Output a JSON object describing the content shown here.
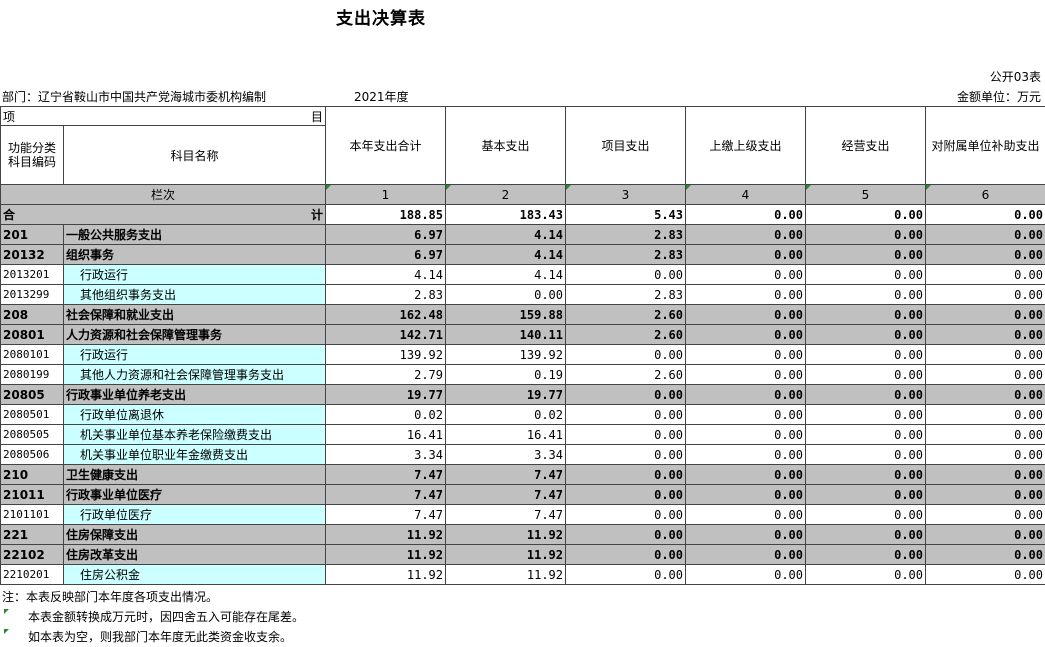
{
  "title": "支出决算表",
  "form_no": "公开03表",
  "department": "部门：辽宁省鞍山市中国共产党海城市委机构编制",
  "year": "2021年度",
  "unit": "金额单位：万元",
  "header": {
    "item_left": "项",
    "item_right": "目",
    "code_label": "功能分类科目编码",
    "name_label": "科目名称",
    "columns": [
      "本年支出合计",
      "基本支出",
      "项目支出",
      "上缴上级支出",
      "经营支出",
      "对附属单位补助支出"
    ],
    "lanci": "栏次",
    "col_numbers": [
      "1",
      "2",
      "3",
      "4",
      "5",
      "6"
    ]
  },
  "total": {
    "left": "合",
    "right": "计",
    "values": [
      "188.85",
      "183.43",
      "5.43",
      "0.00",
      "0.00",
      "0.00"
    ]
  },
  "rows": [
    {
      "level": 1,
      "code": "201",
      "name": "一般公共服务支出",
      "values": [
        "6.97",
        "4.14",
        "2.83",
        "0.00",
        "0.00",
        "0.00"
      ]
    },
    {
      "level": 2,
      "code": "20132",
      "name": "组织事务",
      "values": [
        "6.97",
        "4.14",
        "2.83",
        "0.00",
        "0.00",
        "0.00"
      ]
    },
    {
      "level": 3,
      "code": "2013201",
      "name": "行政运行",
      "values": [
        "4.14",
        "4.14",
        "0.00",
        "0.00",
        "0.00",
        "0.00"
      ]
    },
    {
      "level": 3,
      "code": "2013299",
      "name": "其他组织事务支出",
      "values": [
        "2.83",
        "0.00",
        "2.83",
        "0.00",
        "0.00",
        "0.00"
      ]
    },
    {
      "level": 1,
      "code": "208",
      "name": "社会保障和就业支出",
      "values": [
        "162.48",
        "159.88",
        "2.60",
        "0.00",
        "0.00",
        "0.00"
      ]
    },
    {
      "level": 2,
      "code": "20801",
      "name": "人力资源和社会保障管理事务",
      "values": [
        "142.71",
        "140.11",
        "2.60",
        "0.00",
        "0.00",
        "0.00"
      ]
    },
    {
      "level": 3,
      "code": "2080101",
      "name": "行政运行",
      "values": [
        "139.92",
        "139.92",
        "0.00",
        "0.00",
        "0.00",
        "0.00"
      ]
    },
    {
      "level": 3,
      "code": "2080199",
      "name": "其他人力资源和社会保障管理事务支出",
      "values": [
        "2.79",
        "0.19",
        "2.60",
        "0.00",
        "0.00",
        "0.00"
      ]
    },
    {
      "level": 2,
      "code": "20805",
      "name": "行政事业单位养老支出",
      "values": [
        "19.77",
        "19.77",
        "0.00",
        "0.00",
        "0.00",
        "0.00"
      ]
    },
    {
      "level": 3,
      "code": "2080501",
      "name": "行政单位离退休",
      "values": [
        "0.02",
        "0.02",
        "0.00",
        "0.00",
        "0.00",
        "0.00"
      ]
    },
    {
      "level": 3,
      "code": "2080505",
      "name": "机关事业单位基本养老保险缴费支出",
      "values": [
        "16.41",
        "16.41",
        "0.00",
        "0.00",
        "0.00",
        "0.00"
      ]
    },
    {
      "level": 3,
      "code": "2080506",
      "name": "机关事业单位职业年金缴费支出",
      "values": [
        "3.34",
        "3.34",
        "0.00",
        "0.00",
        "0.00",
        "0.00"
      ]
    },
    {
      "level": 1,
      "code": "210",
      "name": "卫生健康支出",
      "values": [
        "7.47",
        "7.47",
        "0.00",
        "0.00",
        "0.00",
        "0.00"
      ]
    },
    {
      "level": 2,
      "code": "21011",
      "name": "行政事业单位医疗",
      "values": [
        "7.47",
        "7.47",
        "0.00",
        "0.00",
        "0.00",
        "0.00"
      ]
    },
    {
      "level": 3,
      "code": "2101101",
      "name": "行政单位医疗",
      "values": [
        "7.47",
        "7.47",
        "0.00",
        "0.00",
        "0.00",
        "0.00"
      ]
    },
    {
      "level": 1,
      "code": "221",
      "name": "住房保障支出",
      "values": [
        "11.92",
        "11.92",
        "0.00",
        "0.00",
        "0.00",
        "0.00"
      ]
    },
    {
      "level": 2,
      "code": "22102",
      "name": "住房改革支出",
      "values": [
        "11.92",
        "11.92",
        "0.00",
        "0.00",
        "0.00",
        "0.00"
      ]
    },
    {
      "level": 3,
      "code": "2210201",
      "name": "住房公积金",
      "values": [
        "11.92",
        "11.92",
        "0.00",
        "0.00",
        "0.00",
        "0.00"
      ]
    }
  ],
  "notes": [
    "注：本表反映部门本年度各项支出情况。",
    "本表金额转换成万元时，因四舍五入可能存在尾差。",
    "如本表为空，则我部门本年度无此类资金收支余。"
  ]
}
